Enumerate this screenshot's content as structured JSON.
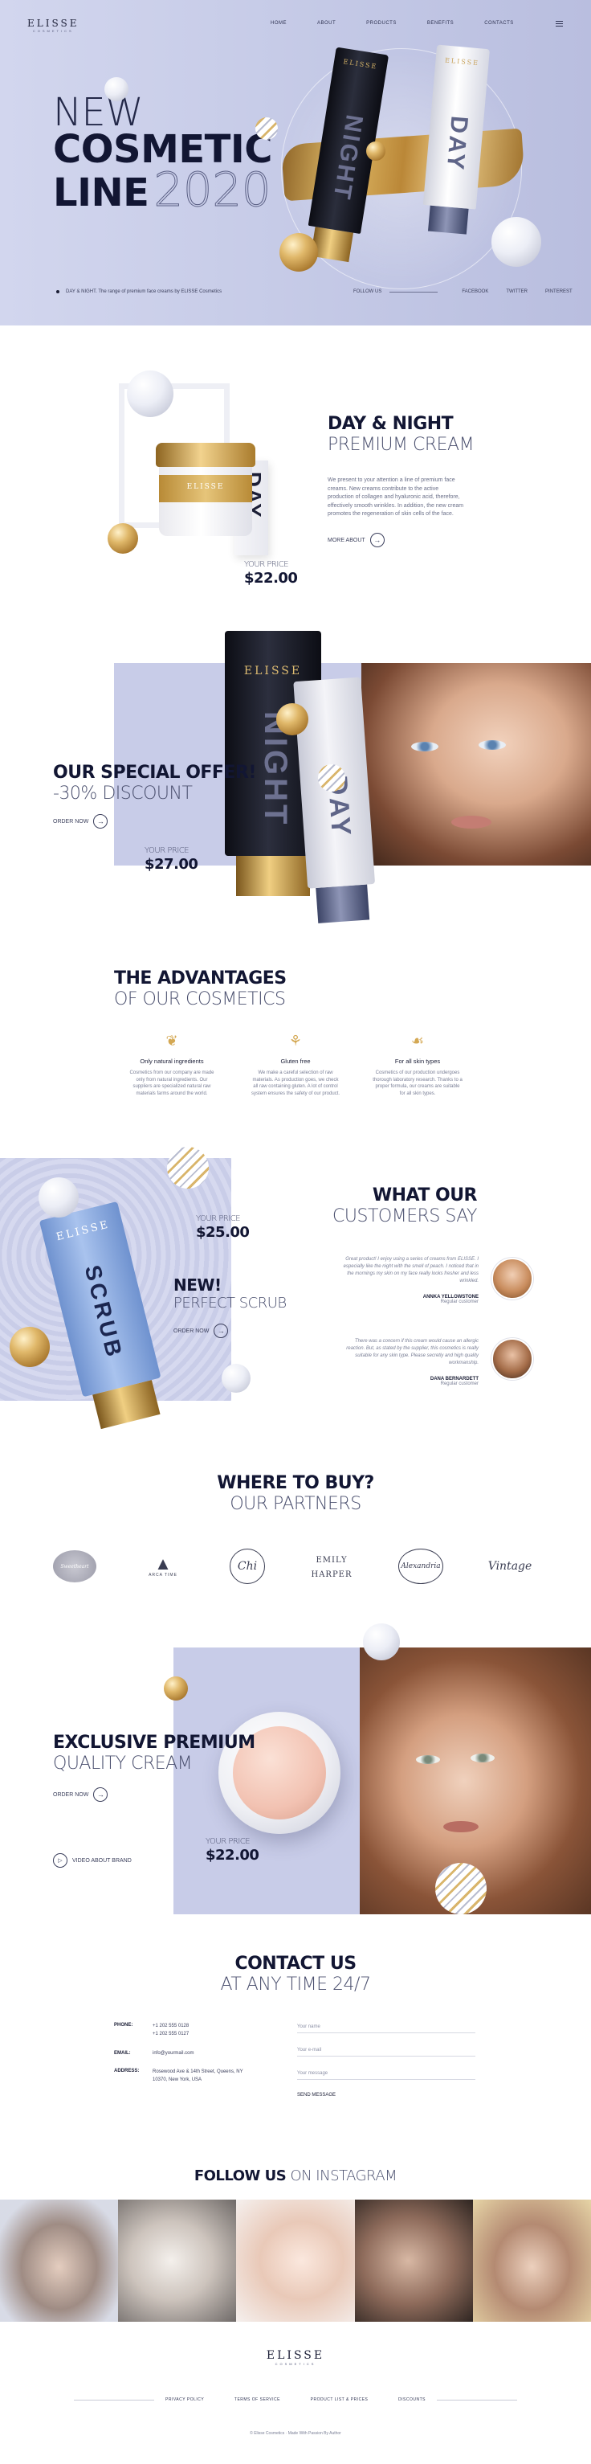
{
  "brand": {
    "name": "ELISSE",
    "tagline": "COSMETICS"
  },
  "nav": {
    "items": [
      "HOME",
      "ABOUT",
      "PRODUCTS",
      "BENEFITS",
      "CONTACTS"
    ],
    "menu_icon": "hamburger-icon"
  },
  "hero": {
    "line1": "NEW",
    "line2": "COSMETIC",
    "line3": "LINE",
    "year": "2020",
    "caption": "DAY & NIGHT. The range of premium face creams by ELISSE Cosmetics",
    "follow_label": "FOLLOW US",
    "socials": [
      "FACEBOOK",
      "TWITTER",
      "PINTEREST"
    ],
    "tube_dark_text": "NIGHT",
    "tube_light_text": "DAY",
    "tube_brand": "ELISSE"
  },
  "product1": {
    "title": "DAY & NIGHT",
    "subtitle": "PREMIUM CREAM",
    "description": "We present to your attention a line of premium face creams. New creams contribute to the active production of collagen and hyaluronic acid, therefore, effectively smooth wrinkles. In addition, the new cream promotes the regeneration of skin cells of the face.",
    "more_label": "MORE ABOUT",
    "price_label": "YOUR PRICE",
    "price": "$22.00",
    "jar_label": "ELISSE",
    "box_text": "DAY"
  },
  "offer": {
    "title": "OUR SPECIAL OFFER!",
    "discount": "-30% DISCOUNT",
    "order_label": "ORDER NOW",
    "price_label": "YOUR PRICE",
    "price": "$27.00",
    "tube_dark_text": "NIGHT",
    "tube_light_text": "DAY",
    "tube_brand": "ELISSE"
  },
  "advantages": {
    "title": "THE ADVANTAGES",
    "subtitle": "OF OUR COSMETICS",
    "items": [
      {
        "icon": "leaf-icon",
        "title": "Only natural ingredients",
        "text": "Cosmetics from our company are made only from natural ingredients. Our suppliers are specialized natural raw materials farms around the world."
      },
      {
        "icon": "wheat-icon",
        "title": "Gluten free",
        "text": "We make a careful selection of raw materials. As production goes, we check all raw containing gluten. A lot of control system ensures the safety of our product."
      },
      {
        "icon": "hand-drop-icon",
        "title": "For all skin types",
        "text": "Cosmetics of our production undergoes thorough laboratory research. Thanks to a proper formula, our creams are suitable for all skin types."
      }
    ]
  },
  "scrub": {
    "price_label": "YOUR PRICE",
    "price": "$25.00",
    "title": "NEW!",
    "subtitle": "PERFECT SCRUB",
    "order_label": "ORDER NOW",
    "tube_text": "SCRUB",
    "tube_brand": "ELISSE"
  },
  "reviews": {
    "title": "WHAT OUR",
    "subtitle": "CUSTOMERS SAY",
    "items": [
      {
        "text": "Great product! I enjoy using a series of creams from ELISSE. I especially like the night with the smell of peach. I noticed that in the mornings my skin on my face really looks fresher and less wrinkled.",
        "name": "ANNKA YELLOWSTONE",
        "role": "Regular customer"
      },
      {
        "text": "There was a concern if this cream would cause an allergic reaction. But, as stated by the supplier, this cosmetics is really suitable for any skin type. Please secretly and high quality workmanship.",
        "name": "DANA BERNARDETT",
        "role": "Regular customer"
      }
    ]
  },
  "partners": {
    "title": "WHERE TO BUY?",
    "subtitle": "OUR PARTNERS",
    "logos": [
      "Sweetheart",
      "ARCA TIME",
      "Chi",
      "EMILY HARPER",
      "Alexandria",
      "Vintage"
    ]
  },
  "exclusive": {
    "title": "EXCLUSIVE PREMIUM",
    "subtitle": "QUALITY CREAM",
    "order_label": "ORDER NOW",
    "video_label": "VIDEO ABOUT BRAND",
    "price_label": "YOUR PRICE",
    "price": "$22.00"
  },
  "contact": {
    "title": "CONTACT US",
    "subtitle": "AT ANY TIME 24/7",
    "phone_label": "PHONE:",
    "phones": [
      "+1 202 555 0128",
      "+1 202 555 0127"
    ],
    "email_label": "EMAIL:",
    "email": "info@yourmail.com",
    "address_label": "ADDRESS:",
    "address": "Rosewood Ave & 14th Street, Queens, NY 10370, New York, USA",
    "form": {
      "name_placeholder": "Your name",
      "email_placeholder": "Your e-mail",
      "message_placeholder": "Your message",
      "send_label": "SEND MESSAGE"
    }
  },
  "instagram": {
    "title_bold": "FOLLOW US",
    "title_thin": "ON INSTAGRAM"
  },
  "footer": {
    "links": [
      "PRIVACY POLICY",
      "TERMS OF SERVICE",
      "PRODUCT LIST & PRICES",
      "DISCOUNTS"
    ],
    "copyright": "© Elisse Cosmetics · Made With Passion By Author"
  },
  "colors": {
    "lavender": "#c9cde8",
    "navy": "#121633",
    "gold": "#d4a853"
  }
}
